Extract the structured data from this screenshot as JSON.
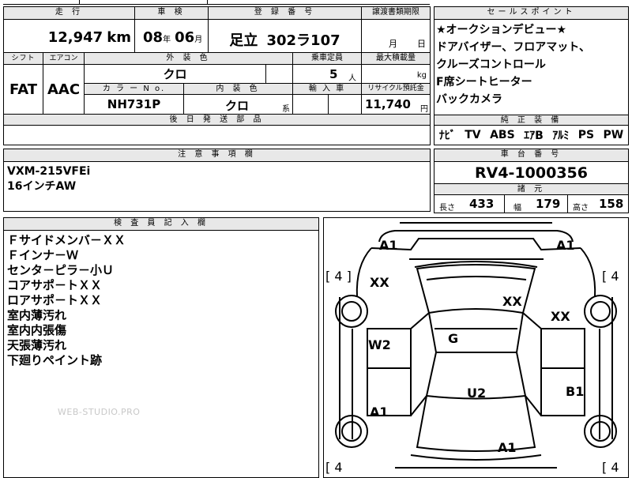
{
  "header": {
    "mileage_label": "走 行",
    "inspection_label": "車 検",
    "registration_label": "登 録 番 号",
    "transfer_label": "譲渡書類期限",
    "sales_point_label": "セールスポイント"
  },
  "values": {
    "mileage": "12,947",
    "mileage_unit": "km",
    "inspection_year": "08",
    "year_unit": "年",
    "inspection_month": "06",
    "month_unit": "月",
    "registration_region": "足立",
    "registration_number": "302ラ107",
    "transfer_month_unit": "月",
    "transfer_day_unit": "日"
  },
  "specs": {
    "shift_label": "シフト",
    "aircon_label": "エアコン",
    "exterior_label": "外 装 色",
    "capacity_label": "乗車定員",
    "max_load_label": "最大積載量",
    "shift": "FAT",
    "aircon": "AAC",
    "exterior_color": "クロ",
    "capacity": "5",
    "capacity_unit": "人",
    "max_load_unit": "kg",
    "color_no_label": "カ ラ ー N o.",
    "interior_label": "内 装 色",
    "import_label": "輸 入 車",
    "recycle_label": "リサイクル預託金",
    "color_no": "NH731P",
    "interior_color": "クロ",
    "interior_suffix": "系",
    "recycle_fee": "11,740",
    "recycle_unit": "円",
    "later_parts_label": "後 日 発 送 部 品"
  },
  "sales_points": {
    "items": [
      "★オークションデビュー★",
      "ドアバイザー、フロアマット、",
      "クルーズコントロール",
      "F席シートヒーター",
      "バックカメラ"
    ]
  },
  "equipment": {
    "label": "純 正 装 備",
    "items": [
      "ﾅﾋﾞ",
      "TV",
      "ABS",
      "ｴｱB",
      "ｱﾙﾐ",
      "PS",
      "PW"
    ]
  },
  "notes": {
    "label": "注 意 事 項 欄",
    "lines": [
      "VXM-215VFEi",
      "16インチAW"
    ]
  },
  "chassis": {
    "label": "車 台 番 号",
    "number": "RV4-1000356"
  },
  "dimensions": {
    "label": "諸 元",
    "length_label": "長さ",
    "length": "433",
    "width_label": "幅",
    "width": "179",
    "height_label": "高さ",
    "height": "158"
  },
  "inspector": {
    "label": "検 査 員 記 入 欄",
    "lines": [
      "Ｆサイドメンバ－ＸＸ",
      "Ｆインナ－Ｗ",
      "センタ－ピラ－小Ｕ",
      "コアサポ－トＸＸ",
      "ロアサポ－トＸＸ",
      "室内薄汚れ",
      "室内内張傷",
      "天張薄汚れ",
      "下廻りペイント跡"
    ]
  },
  "diagram": {
    "tire_front_left": "[ 4 ]",
    "tire_front_right": "[ 4",
    "tire_rear_left": "[ 4",
    "tire_rear_right": "[ 4",
    "marks": {
      "a1_front_left": "A1",
      "a1_front_right": "A1",
      "xx_left": "XX",
      "xx_center": "XX",
      "xx_right": "XX",
      "w2": "W2",
      "g": "G",
      "u2": "U2",
      "b1": "B1",
      "a1_rear_left": "A1",
      "a1_rear": "A1"
    }
  },
  "watermark": "WEB-STUDIO.PRO"
}
